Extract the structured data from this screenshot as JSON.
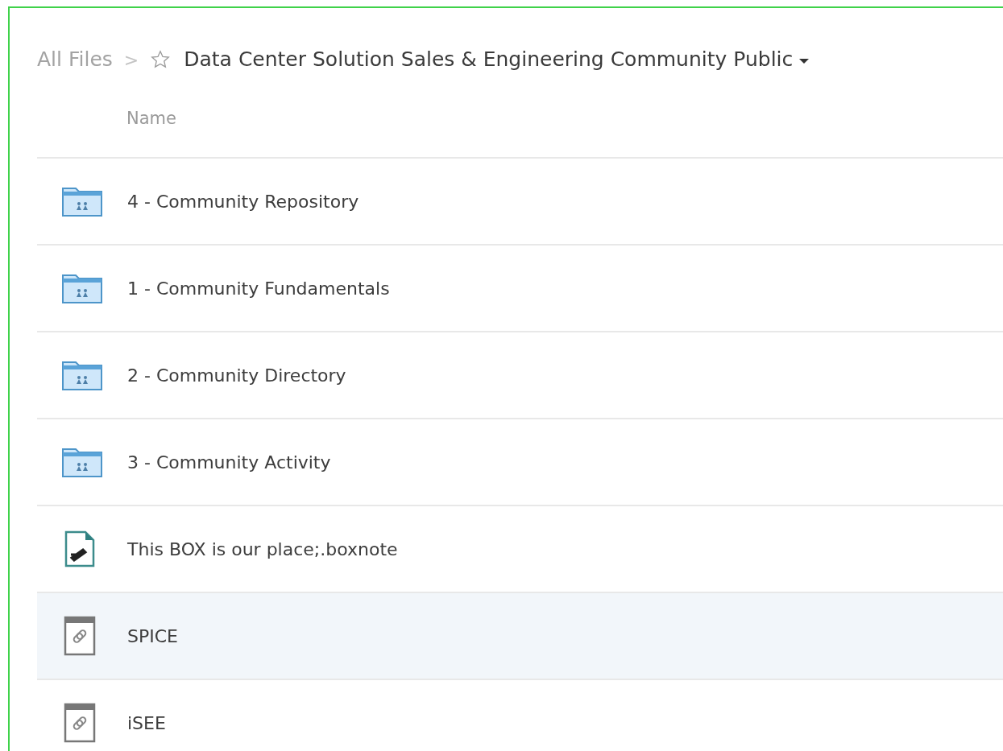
{
  "breadcrumb": {
    "root": "All Files",
    "separator": ">",
    "current": "Data Center Solution Sales & Engineering Community Public",
    "starred": false
  },
  "table": {
    "columns": [
      "Name"
    ],
    "rows": [
      {
        "kind": "folder",
        "name": "4 - Community Repository",
        "selected": false
      },
      {
        "kind": "folder",
        "name": "1 - Community Fundamentals",
        "selected": false
      },
      {
        "kind": "folder",
        "name": "2 - Community Directory",
        "selected": false
      },
      {
        "kind": "folder",
        "name": "3 - Community Activity",
        "selected": false
      },
      {
        "kind": "note",
        "name": "This BOX is our place;.boxnote",
        "selected": false
      },
      {
        "kind": "bookmark",
        "name": "SPICE",
        "selected": true
      },
      {
        "kind": "bookmark",
        "name": "iSEE",
        "selected": false
      }
    ]
  }
}
